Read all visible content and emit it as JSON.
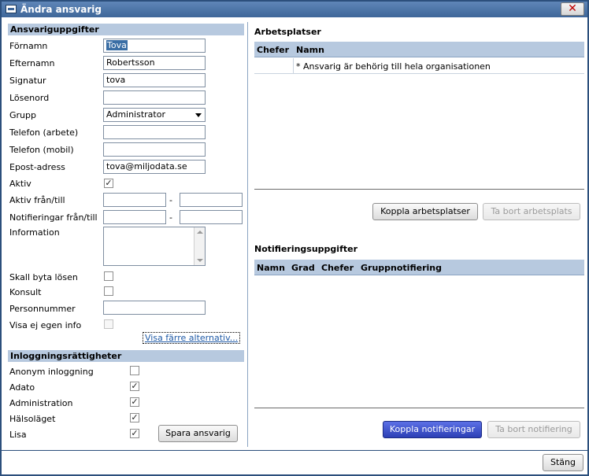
{
  "window": {
    "title": "Ändra ansvarig",
    "close_label": "✕"
  },
  "left": {
    "section_ansvarig": "Ansvariguppgifter",
    "labels": {
      "fornamn": "Förnamn",
      "efternamn": "Efternamn",
      "signatur": "Signatur",
      "losenord": "Lösenord",
      "grupp": "Grupp",
      "telefon_arbete": "Telefon (arbete)",
      "telefon_mobil": "Telefon (mobil)",
      "epost": "Epost-adress",
      "aktiv": "Aktiv",
      "aktiv_fran_till": "Aktiv från/till",
      "notif_fran_till": "Notifieringar från/till",
      "information": "Information",
      "skall_byta": "Skall byta lösen",
      "konsult": "Konsult",
      "personnummer": "Personnummer",
      "visa_ej": "Visa ej egen info"
    },
    "values": {
      "fornamn": "Tova",
      "efternamn": "Robertsson",
      "signatur": "tova",
      "losenord": "",
      "grupp": "Administrator",
      "telefon_arbete": "",
      "telefon_mobil": "",
      "epost": "tova@miljodata.se",
      "aktiv_fran": "",
      "aktiv_till": "",
      "notif_fran": "",
      "notif_till": "",
      "information": "",
      "personnummer": ""
    },
    "checks": {
      "aktiv": "✓",
      "skall_byta": "",
      "konsult": "",
      "visa_ej": "",
      "anonym": "",
      "adato": "✓",
      "administration": "✓",
      "halsolaget": "✓",
      "lisa": "✓"
    },
    "dash": "-",
    "visa_farre": "Visa färre alternativ...",
    "section_login": "Inloggningsrättigheter",
    "login_labels": {
      "anonym": "Anonym inloggning",
      "adato": "Adato",
      "administration": "Administration",
      "halsolaget": "Hälsoläget",
      "lisa": "Lisa"
    },
    "spara_label": "Spara ansvarig"
  },
  "right": {
    "arbetsplatser_title": "Arbetsplatser",
    "arbetsplatser_columns": [
      "Chefer",
      "Namn"
    ],
    "arbetsplatser_rows": [
      "* Ansvarig är behörig till hela organisationen"
    ],
    "koppla_arbetsplatser": "Koppla arbetsplatser",
    "ta_bort_arbetsplats": "Ta bort arbetsplats",
    "notif_title": "Notifieringsuppgifter",
    "notif_columns": [
      "Namn",
      "Grad",
      "Chefer",
      "Gruppnotifiering"
    ],
    "koppla_notifieringar": "Koppla notifieringar",
    "ta_bort_notifiering": "Ta bort notifiering"
  },
  "footer": {
    "stang_label": "Stäng"
  },
  "colors": {
    "titlebar": "#3e6699",
    "section": "#b7c9df",
    "primary_button": "#2c3fb5",
    "border": "#2c4f7c"
  }
}
